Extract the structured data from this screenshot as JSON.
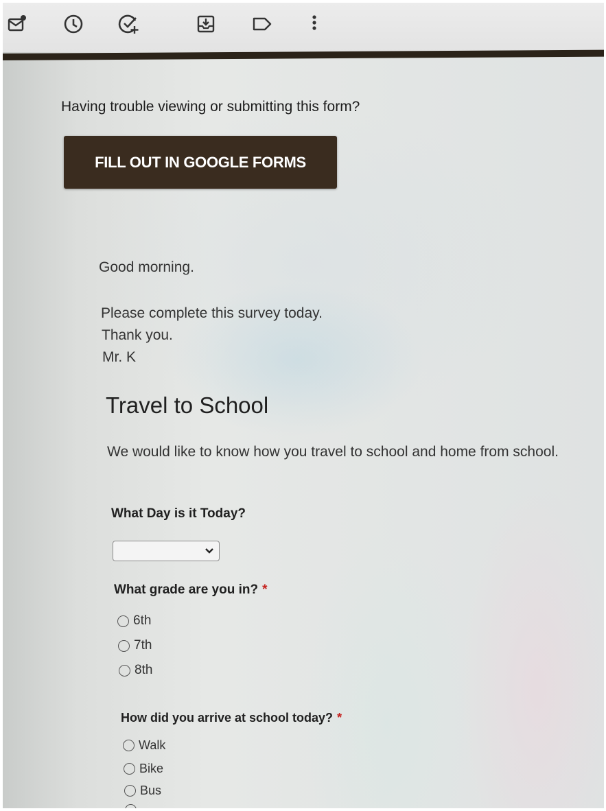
{
  "toolbar": {
    "icons": [
      "mark-unread-icon",
      "snooze-icon",
      "add-task-icon",
      "move-to-inbox-icon",
      "label-icon",
      "more-vertical-icon"
    ]
  },
  "form": {
    "trouble_text": "Having trouble viewing or submitting this form?",
    "gforms_button": "FILL OUT IN GOOGLE FORMS",
    "message": {
      "greeting": "Good morning.",
      "line1": "Please complete this survey today.",
      "line2": "Thank you.",
      "signature": "Mr. K"
    },
    "section": {
      "title": "Travel to School",
      "description": "We would like to know how you travel to school and home from school."
    },
    "questions": [
      {
        "label": "What Day is it Today?",
        "type": "dropdown",
        "selected": ""
      },
      {
        "label": "What grade are you in?",
        "required_mark": "*",
        "type": "radio",
        "options": [
          "6th",
          "7th",
          "8th"
        ]
      },
      {
        "label": "How did you arrive at school today?",
        "required_mark": "*",
        "type": "radio",
        "options": [
          "Walk",
          "Bike",
          "Bus"
        ]
      }
    ]
  },
  "colors": {
    "button_bg": "#3a2c1f",
    "top_rule": "#2b2319",
    "required": "#c5221f"
  }
}
